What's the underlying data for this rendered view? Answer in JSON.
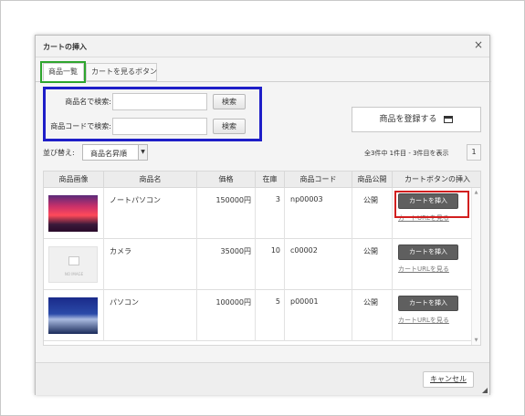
{
  "dialog": {
    "title": "カートの挿入",
    "close": "×"
  },
  "tabs": [
    {
      "label": "商品一覧"
    },
    {
      "label": "カートを見るボタン"
    }
  ],
  "search": {
    "name_label": "商品名で検索:",
    "code_label": "商品コードで検索:",
    "button_label": "検索",
    "name_value": "",
    "code_value": ""
  },
  "register": {
    "label": "商品を登録する"
  },
  "sort": {
    "label": "並び替え:",
    "selected": "商品名昇順"
  },
  "pagination": {
    "count_text": "全3件中 1件目 - 3件目を表示",
    "page": "1"
  },
  "table": {
    "headers": [
      "商品画像",
      "商品名",
      "価格",
      "在庫",
      "商品コード",
      "商品公開",
      "カートボタンの挿入"
    ],
    "rows": [
      {
        "name": "ノートパソコン",
        "price": "150000円",
        "stock": "3",
        "code": "np00003",
        "public": "公開",
        "image": "sunset"
      },
      {
        "name": "カメラ",
        "price": "35000円",
        "stock": "10",
        "code": "c00002",
        "public": "公開",
        "image": "noimage"
      },
      {
        "name": "パソコン",
        "price": "100000円",
        "stock": "5",
        "code": "p00001",
        "public": "公開",
        "image": "forest"
      }
    ],
    "cart_button_label": "カートを挿入",
    "cart_link_label": "カートURLを見る",
    "noimage_text": "NO IMAGE"
  },
  "footer": {
    "cancel_label": "キャンセル"
  },
  "colors": {
    "highlight_green": "#2ea52e",
    "highlight_blue": "#1e1ec8",
    "highlight_red": "#d21f1f",
    "cart_button": "#5f5f5f"
  }
}
